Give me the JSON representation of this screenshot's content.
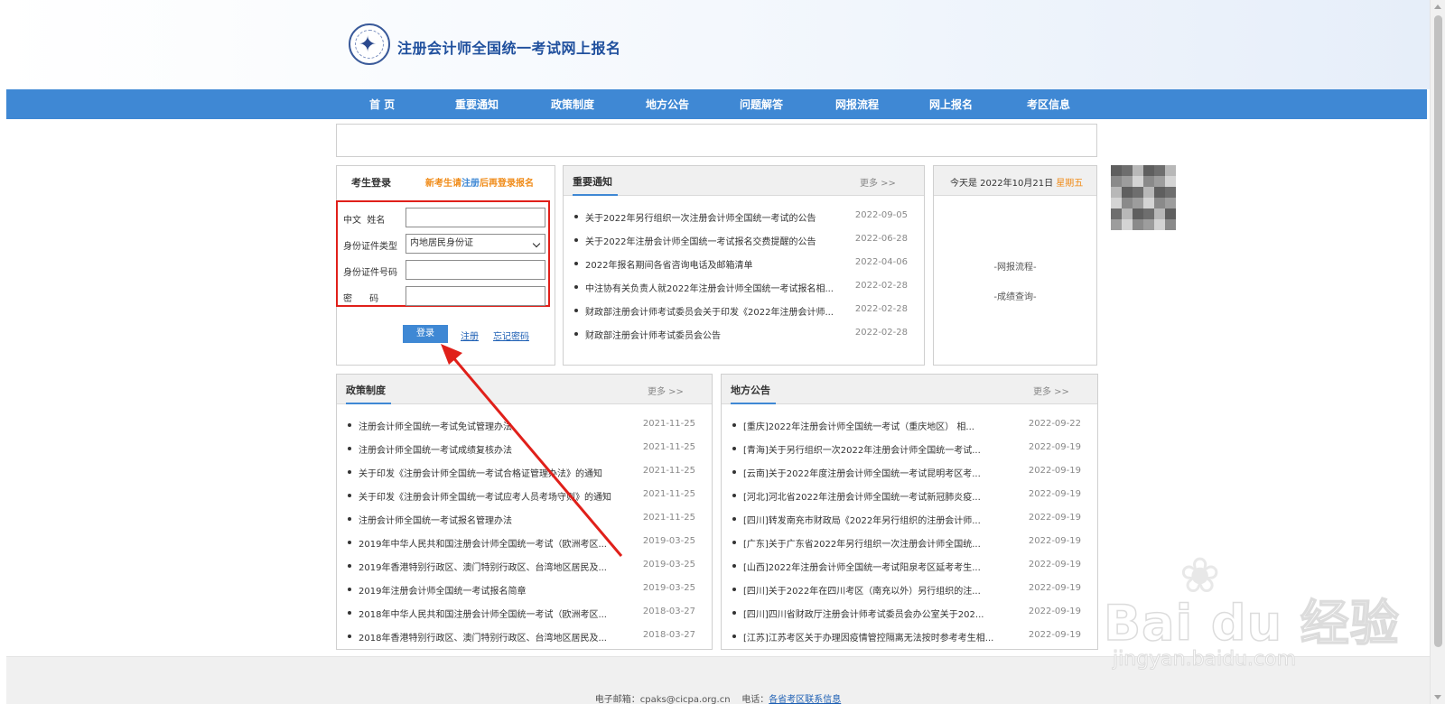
{
  "header": {
    "title": "注册会计师全国统一考试网上报名"
  },
  "nav": [
    "首 页",
    "重要通知",
    "政策制度",
    "地方公告",
    "问题解答",
    "网报流程",
    "网上报名",
    "考区信息"
  ],
  "login": {
    "title": "考生登录",
    "hint_prefix": "新考生请",
    "hint_link": "注册",
    "hint_suffix": "后再登录报名",
    "fields": {
      "name_label": "中文  姓名",
      "id_type_label": "身份证件类型",
      "id_type_value": "内地居民身份证",
      "id_number_label": "身份证件号码",
      "password_label": "密      码"
    },
    "login_button": "登录",
    "register_link": "注册",
    "forgot_link": "忘记密码"
  },
  "notices": {
    "title": "重要通知",
    "more": "更多 >>",
    "items": [
      {
        "title": "关于2022年另行组织一次注册会计师全国统一考试的公告",
        "date": "2022-09-05"
      },
      {
        "title": "关于2022年注册会计师全国统一考试报名交费提醒的公告",
        "date": "2022-06-28"
      },
      {
        "title": "2022年报名期间各省咨询电话及邮箱清单",
        "date": "2022-04-06"
      },
      {
        "title": "中注协有关负责人就2022年注册会计师全国统一考试报名相...",
        "date": "2022-02-28"
      },
      {
        "title": "财政部注册会计师考试委员会关于印发《2022年注册会计师...",
        "date": "2022-02-28"
      },
      {
        "title": "财政部注册会计师考试委员会公告",
        "date": "2022-02-28"
      }
    ]
  },
  "side": {
    "date_prefix": "今天是 2022年10月21日 ",
    "weekday": "星期五",
    "links": [
      "-网报流程-",
      "-成绩查询-"
    ]
  },
  "policy": {
    "title": "政策制度",
    "more": "更多 >>",
    "items": [
      {
        "title": "注册会计师全国统一考试免试管理办法",
        "date": "2021-11-25"
      },
      {
        "title": "注册会计师全国统一考试成绩复核办法",
        "date": "2021-11-25"
      },
      {
        "title": "关于印发《注册会计师全国统一考试合格证管理办法》的通知",
        "date": "2021-11-25"
      },
      {
        "title": "关于印发《注册会计师全国统一考试应考人员考场守则》的通知",
        "date": "2021-11-25"
      },
      {
        "title": "注册会计师全国统一考试报名管理办法",
        "date": "2021-11-25"
      },
      {
        "title": "2019年中华人民共和国注册会计师全国统一考试（欧洲考区...",
        "date": "2019-03-25"
      },
      {
        "title": "2019年香港特别行政区、澳门特别行政区、台湾地区居民及...",
        "date": "2019-03-25"
      },
      {
        "title": "2019年注册会计师全国统一考试报名简章",
        "date": "2019-03-25"
      },
      {
        "title": "2018年中华人民共和国注册会计师全国统一考试（欧洲考区...",
        "date": "2018-03-27"
      },
      {
        "title": "2018年香港特别行政区、澳门特别行政区、台湾地区居民及...",
        "date": "2018-03-27"
      }
    ]
  },
  "local": {
    "title": "地方公告",
    "more": "更多 >>",
    "items": [
      {
        "title": "[重庆]2022年注册会计师全国统一考试（重庆地区） 相...",
        "date": "2022-09-22"
      },
      {
        "title": "[青海]关于另行组织一次2022年注册会计师全国统一考试...",
        "date": "2022-09-19"
      },
      {
        "title": "[云南]关于2022年度注册会计师全国统一考试昆明考区考...",
        "date": "2022-09-19"
      },
      {
        "title": "[河北]河北省2022年注册会计师全国统一考试新冠肺炎疫...",
        "date": "2022-09-19"
      },
      {
        "title": "[四川]转发南充市财政局《2022年另行组织的注册会计师...",
        "date": "2022-09-19"
      },
      {
        "title": "[广东]关于广东省2022年另行组织一次注册会计师全国统...",
        "date": "2022-09-19"
      },
      {
        "title": "[山西]2022年注册会计师全国统一考试阳泉考区延考考生...",
        "date": "2022-09-19"
      },
      {
        "title": "[四川]关于2022年在四川考区（南充以外）另行组织的注...",
        "date": "2022-09-19"
      },
      {
        "title": "[四川]四川省财政厅注册会计师考试委员会办公室关于202...",
        "date": "2022-09-19"
      },
      {
        "title": "[江苏]江苏考区关于办理因疫情管控隔离无法按时参考考生相...",
        "date": "2022-09-19"
      }
    ]
  },
  "footer": {
    "email_label": "电子邮箱：",
    "email": "cpaks@cicpa.org.cn",
    "phone_label": "电话：",
    "phone_link": "各省考区联系信息"
  },
  "watermark": {
    "brand": "Bai du 经验",
    "domain": "jingyan.baidu.com"
  },
  "colors": {
    "nav": "#3f88d4",
    "annotation": "#e0201a",
    "hint": "#f08c1a"
  }
}
